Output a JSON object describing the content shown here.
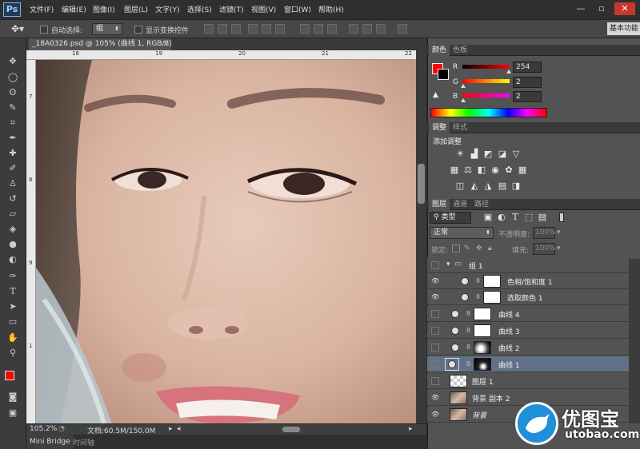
{
  "app": {
    "logo": "Ps"
  },
  "menu": [
    "文件(F)",
    "编辑(E)",
    "图像(I)",
    "图层(L)",
    "文字(Y)",
    "选择(S)",
    "滤镜(T)",
    "视图(V)",
    "窗口(W)",
    "帮助(H)"
  ],
  "window_controls": {
    "minimize": "—",
    "restore": "▫",
    "close": "✕"
  },
  "options": {
    "auto_select_label": "自动选择:",
    "auto_select_value": "组",
    "show_transform_label": "显示变换控件",
    "workspace": "基本功能"
  },
  "document": {
    "tab_title": "_18A0326.psd @ 105% (曲线 1, RGB/8) *",
    "zoom": "105.2%",
    "doc_info": "文档:60.5M/150.0M",
    "ruler_top_ticks": [
      "18",
      "19",
      "20",
      "21",
      "22"
    ],
    "ruler_left_ticks": [
      "7",
      "8",
      "9",
      "1"
    ]
  },
  "bottom_tabs": [
    "Mini Bridge",
    "时间轴"
  ],
  "color_panel": {
    "tabs": [
      "颜色",
      "色板"
    ],
    "channels": [
      {
        "label": "R",
        "value": "254"
      },
      {
        "label": "G",
        "value": "2"
      },
      {
        "label": "B",
        "value": "2"
      }
    ],
    "foreground_color": "#fe0202"
  },
  "adjust_panel": {
    "tabs": [
      "调整",
      "样式"
    ],
    "title": "添加调整"
  },
  "layers_panel": {
    "tabs": [
      "图层",
      "通道",
      "路径"
    ],
    "filter_kind": "类型",
    "blend_mode": "正常",
    "opacity_label": "不透明度:",
    "opacity_value": "100%",
    "lock_label": "锁定:",
    "fill_label": "填充:",
    "fill_value": "100%",
    "layers": [
      {
        "name": "组 1",
        "type": "group",
        "visible": false,
        "selected": false
      },
      {
        "name": "色相/饱和度 1",
        "type": "adjust",
        "visible": true,
        "selected": false
      },
      {
        "name": "选取颜色 1",
        "type": "adjust",
        "visible": true,
        "selected": false
      },
      {
        "name": "曲线 4",
        "type": "adjust",
        "visible": false,
        "selected": false
      },
      {
        "name": "曲线 3",
        "type": "adjust",
        "visible": false,
        "selected": false
      },
      {
        "name": "曲线 2",
        "type": "adjust",
        "visible": false,
        "selected": false
      },
      {
        "name": "曲线 1",
        "type": "adjust",
        "visible": false,
        "selected": true
      },
      {
        "name": "图层 1",
        "type": "pixel",
        "visible": false,
        "selected": false
      },
      {
        "name": "背景 副本 2",
        "type": "photo",
        "visible": true,
        "selected": false
      },
      {
        "name": "背景",
        "type": "photo",
        "visible": true,
        "selected": false
      }
    ]
  },
  "watermark": {
    "brand": "优图宝",
    "url": "utobao.com"
  }
}
